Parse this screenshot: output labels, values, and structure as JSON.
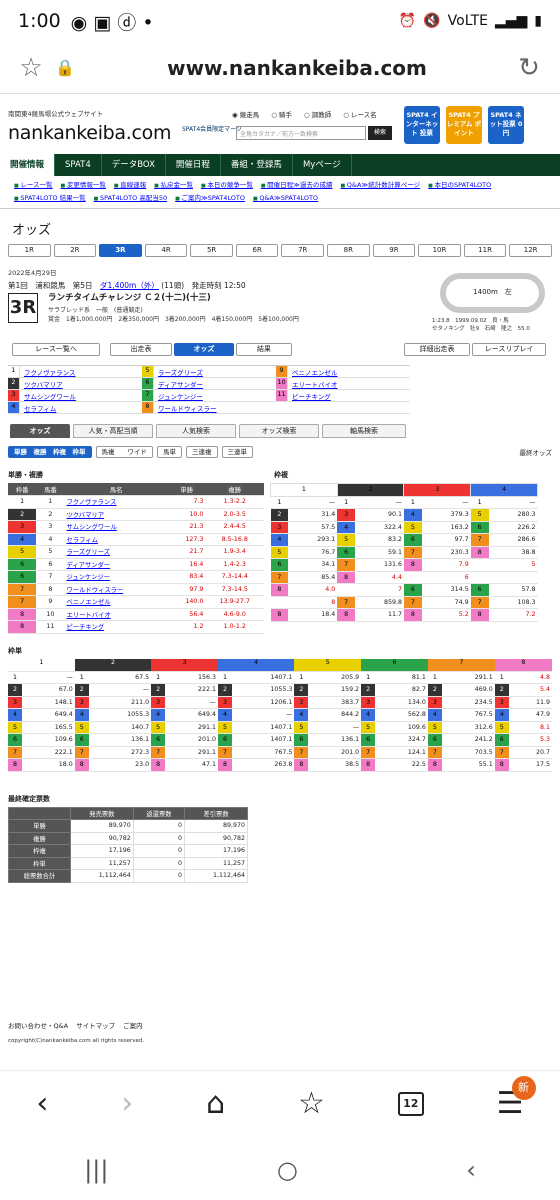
{
  "status": {
    "time": "1:00",
    "right": "VoLTE"
  },
  "browser": {
    "url": "www.nankankeiba.com",
    "tab_count": "12",
    "menu_badge": "新"
  },
  "header": {
    "subtitle": "南関東4競馬場公式ウェブサイト",
    "logo": "nankankeiba.com",
    "radios": [
      "競走馬",
      "騎手",
      "調教師",
      "レース名"
    ],
    "search_placeholder": "全角カタカナ／前方一致検索",
    "search_btn": "検索",
    "spat_mark": "SPAT4会員限定マーク",
    "banners": [
      {
        "text": "SPAT4 インターネット 投票",
        "color": "#1b63c7"
      },
      {
        "text": "SPAT4 プレミアム ポイント",
        "color": "#f0a000"
      },
      {
        "text": "SPAT4 ネット投票 0円",
        "color": "#1b63c7"
      }
    ]
  },
  "gnav": [
    "開催情報",
    "SPAT4",
    "データBOX",
    "開催日程",
    "番組・登録馬",
    "Myページ"
  ],
  "subnav": [
    "レース一覧",
    "変更情報一覧",
    "直線速報",
    "払戻金一覧",
    "本日の競争一覧",
    "開催日程≫過去の成績",
    "Q&A≫統計数計算ページ",
    "本日のSPAT4LOTO",
    "SPAT4LOTO 結果一覧",
    "SPAT4LOTO 高配当50",
    "ご案内≫SPAT4LOTO",
    "Q&A≫SPAT4LOTO"
  ],
  "title": "オッズ",
  "race_tabs": [
    "1R",
    "2R",
    "3R",
    "4R",
    "5R",
    "6R",
    "7R",
    "8R",
    "9R",
    "10R",
    "11R",
    "12R"
  ],
  "race": {
    "date": "2022年4月29日",
    "meeting": "第1回　浦和競馬　第5日",
    "distance": "ダ1,400m（外）",
    "heads": "(11頭)",
    "start": "発走時刻 12:50",
    "no": "3R",
    "name": "ランチタイムチャレンジ Ｃ２(十二)(十三)",
    "cls": "サラブレッド系　一般　(普通競走)",
    "prize": "賞金　1着1,000,000円　2着350,000円　3着200,000円　4着150,000円　5着100,000円"
  },
  "course": {
    "label": "1400m　左",
    "record": "1:23.8　1999.09.02　良・馬",
    "record2": "セタノキング　牡9　石崎　隆之　55.0"
  },
  "buttons": {
    "back": "レース一覧へ",
    "entries": "出走表",
    "odds": "オッズ",
    "result": "結果",
    "detail": "詳細出走表",
    "replay": "レースリプレイ"
  },
  "horses": [
    {
      "w": "1",
      "n": "フクノヴァランス"
    },
    {
      "w": "2",
      "n": "ツクバマリア"
    },
    {
      "w": "3",
      "n": "サムシングワール"
    },
    {
      "w": "4",
      "n": "セラフィム"
    },
    {
      "w": "5",
      "n": "ラーズグリーズ"
    },
    {
      "w": "6",
      "n": "ディアサンダー"
    },
    {
      "w": "7",
      "n": "ジュンケンジー"
    },
    {
      "w": "8",
      "n": "ワールドウィスラー"
    },
    {
      "w": "9",
      "n": "ベニノエンゼル"
    },
    {
      "w": "10",
      "n": "エリートバイオ"
    },
    {
      "w": "11",
      "n": "ピーチキング"
    }
  ],
  "odds_tabs": [
    "オッズ",
    "人気・高配当順",
    "人気検索",
    "オッズ検索",
    "軸馬検索"
  ],
  "bet_types": [
    "単勝　複勝　枠複　枠単",
    "馬複　　ワイド",
    "馬単",
    "三連複",
    "三連単"
  ],
  "final": "最終オッズ",
  "tanfuku": {
    "title": "単勝・複勝",
    "headers": [
      "枠番",
      "馬番",
      "馬名",
      "単勝",
      "複勝"
    ],
    "rows": [
      [
        "1",
        "1",
        "フクノヴァランス",
        "7.3",
        "1.3-2.2"
      ],
      [
        "2",
        "2",
        "ツクバマリア",
        "10.0",
        "2.0-3.5"
      ],
      [
        "3",
        "3",
        "サムシングワール",
        "21.3",
        "2.4-4.5"
      ],
      [
        "4",
        "4",
        "セラフィム",
        "127.3",
        "8.5-16.8"
      ],
      [
        "5",
        "5",
        "ラーズグリーズ",
        "21.7",
        "1.9-3.4"
      ],
      [
        "6",
        "6",
        "ディアサンダー",
        "16.4",
        "1.4-2.3"
      ],
      [
        "6",
        "7",
        "ジュンケンジー",
        "83.4",
        "7.3-14.4"
      ],
      [
        "7",
        "8",
        "ワールドウィスラー",
        "97.9",
        "7.3-14.5"
      ],
      [
        "7",
        "9",
        "ベニノエンゼル",
        "140.0",
        "13.9-27.7"
      ],
      [
        "8",
        "10",
        "エリートバイオ",
        "56.4",
        "4.6-9.0"
      ],
      [
        "8",
        "11",
        "ピーチキング",
        "1.2",
        "1.0-1.2"
      ]
    ]
  },
  "wakufuku": {
    "title": "枠複",
    "rows": [
      [
        "1",
        "—",
        "1",
        "—",
        "1",
        "—",
        "1",
        "—"
      ],
      [
        "2",
        "31.4",
        "3",
        "90.1",
        "4",
        "379.3",
        "5",
        "280.3"
      ],
      [
        "3",
        "57.5",
        "4",
        "322.4",
        "5",
        "163.2",
        "6",
        "226.2"
      ],
      [
        "4",
        "293.1",
        "5",
        "83.2",
        "6",
        "97.7",
        "7",
        "286.6"
      ],
      [
        "5",
        "76.7",
        "6",
        "59.1",
        "7",
        "230.3",
        "8",
        "38.8"
      ],
      [
        "6",
        "34.1",
        "7",
        "131.6",
        "8",
        "7.9",
        "",
        "5"
      ],
      [
        "7",
        "85.4",
        "8",
        "4.4",
        "",
        "6",
        "",
        ""
      ],
      [
        "8",
        "4.0",
        "",
        "7",
        "6",
        "314.5",
        "6",
        "57.8"
      ],
      [
        "",
        "8",
        "7",
        "859.8",
        "7",
        "74.9",
        "7",
        "108.3"
      ],
      [
        "8",
        "18.4",
        "8",
        "11.7",
        "8",
        "5.2",
        "8",
        "7.2"
      ]
    ]
  },
  "wakutan": {
    "title": "枠単",
    "rows": [
      [
        "1",
        "—",
        "1",
        "67.5",
        "1",
        "156.3",
        "1",
        "1407.1",
        "1",
        "205.9",
        "1",
        "81.1",
        "1",
        "291.1",
        "1",
        "4.8"
      ],
      [
        "2",
        "67.0",
        "2",
        "—",
        "2",
        "222.1",
        "2",
        "1055.3",
        "2",
        "159.2",
        "2",
        "82.7",
        "2",
        "469.0",
        "2",
        "5.4"
      ],
      [
        "3",
        "148.1",
        "3",
        "211.0",
        "3",
        "—",
        "3",
        "1206.1",
        "3",
        "383.7",
        "3",
        "134.0",
        "3",
        "234.5",
        "3",
        "11.9"
      ],
      [
        "4",
        "649.4",
        "4",
        "1055.3",
        "4",
        "649.4",
        "4",
        "—",
        "4",
        "844.2",
        "4",
        "562.8",
        "4",
        "767.5",
        "4",
        "47.9"
      ],
      [
        "5",
        "165.5",
        "5",
        "140.7",
        "5",
        "291.1",
        "5",
        "1407.1",
        "5",
        "—",
        "5",
        "109.6",
        "5",
        "312.6",
        "5",
        "8.1"
      ],
      [
        "6",
        "109.6",
        "6",
        "136.1",
        "6",
        "201.0",
        "6",
        "1407.1",
        "6",
        "136.1",
        "6",
        "324.7",
        "6",
        "241.2",
        "6",
        "5.3"
      ],
      [
        "7",
        "222.1",
        "7",
        "272.3",
        "7",
        "291.1",
        "7",
        "767.5",
        "7",
        "201.0",
        "7",
        "124.1",
        "7",
        "703.5",
        "7",
        "20.7"
      ],
      [
        "8",
        "18.0",
        "8",
        "23.0",
        "8",
        "47.1",
        "8",
        "263.8",
        "8",
        "38.5",
        "8",
        "22.5",
        "8",
        "55.1",
        "8",
        "17.5"
      ]
    ]
  },
  "summary": {
    "title": "最終確定票数",
    "headers": [
      "",
      "発売票数",
      "返還票数",
      "差引票数"
    ],
    "rows": [
      [
        "単勝",
        "89,970",
        "0",
        "89,970"
      ],
      [
        "複勝",
        "90,782",
        "0",
        "90,782"
      ],
      [
        "枠複",
        "17,196",
        "0",
        "17,196"
      ],
      [
        "枠単",
        "11,257",
        "0",
        "11,257"
      ],
      [
        "総票数合計",
        "1,112,464",
        "0",
        "1,112,464"
      ]
    ]
  },
  "footer": {
    "links": [
      "お問い合わせ・Q&A",
      "サイトマップ",
      "ご案内"
    ],
    "copyright": "copyright(C)nankankeiba.com all rights reserved."
  },
  "waku_colors": [
    "#ffffff",
    "#333333",
    "#e33",
    "#3a6fe0",
    "#e8d000",
    "#2aa34a",
    "#f08f1e",
    "#f07ac4"
  ]
}
